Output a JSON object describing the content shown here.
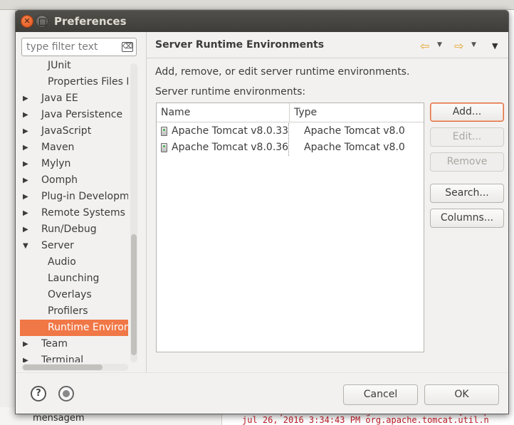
{
  "window": {
    "title": "Preferences"
  },
  "filter": {
    "placeholder": "type filter text"
  },
  "tree": {
    "items": [
      {
        "label": "JUnit",
        "level": 1,
        "arrow": ""
      },
      {
        "label": "Properties Files E",
        "level": 1,
        "arrow": ""
      },
      {
        "label": "Java EE",
        "level": 0,
        "arrow": "▶"
      },
      {
        "label": "Java Persistence",
        "level": 0,
        "arrow": "▶"
      },
      {
        "label": "JavaScript",
        "level": 0,
        "arrow": "▶"
      },
      {
        "label": "Maven",
        "level": 0,
        "arrow": "▶"
      },
      {
        "label": "Mylyn",
        "level": 0,
        "arrow": "▶"
      },
      {
        "label": "Oomph",
        "level": 0,
        "arrow": "▶"
      },
      {
        "label": "Plug-in Developme",
        "level": 0,
        "arrow": "▶"
      },
      {
        "label": "Remote Systems",
        "level": 0,
        "arrow": "▶"
      },
      {
        "label": "Run/Debug",
        "level": 0,
        "arrow": "▶"
      },
      {
        "label": "Server",
        "level": 0,
        "arrow": "▼"
      },
      {
        "label": "Audio",
        "level": 1,
        "arrow": ""
      },
      {
        "label": "Launching",
        "level": 1,
        "arrow": ""
      },
      {
        "label": "Overlays",
        "level": 1,
        "arrow": ""
      },
      {
        "label": "Profilers",
        "level": 1,
        "arrow": ""
      },
      {
        "label": "Runtime Environn",
        "level": 1,
        "arrow": "",
        "selected": true
      },
      {
        "label": "Team",
        "level": 0,
        "arrow": "▶"
      },
      {
        "label": "Terminal",
        "level": 0,
        "arrow": "▶"
      }
    ]
  },
  "page": {
    "title": "Server Runtime Environments",
    "description": "Add, remove, or edit server runtime environments.",
    "list_label": "Server runtime environments:"
  },
  "table": {
    "columns": [
      "Name",
      "Type"
    ],
    "rows": [
      {
        "name": "Apache Tomcat v8.0.33",
        "type": "Apache Tomcat v8.0"
      },
      {
        "name": "Apache Tomcat v8.0.36",
        "type": "Apache Tomcat v8.0"
      }
    ]
  },
  "buttons": {
    "add": "Add...",
    "edit": "Edit...",
    "remove": "Remove",
    "search": "Search...",
    "columns": "Columns...",
    "cancel": "Cancel",
    "ok": "OK"
  },
  "background": {
    "tree_item": "mensagem",
    "console_lines": [
      "INFORMAÇÕES: Initializing ProtocolHandler [\"http",
      "jul 26, 2016 3:34:43 PM org.apache.tomcat.util.n"
    ]
  },
  "colors": {
    "selection": "#f07746",
    "default_button_border": "#e0693a",
    "nav_arrows": "#e6a32a"
  }
}
